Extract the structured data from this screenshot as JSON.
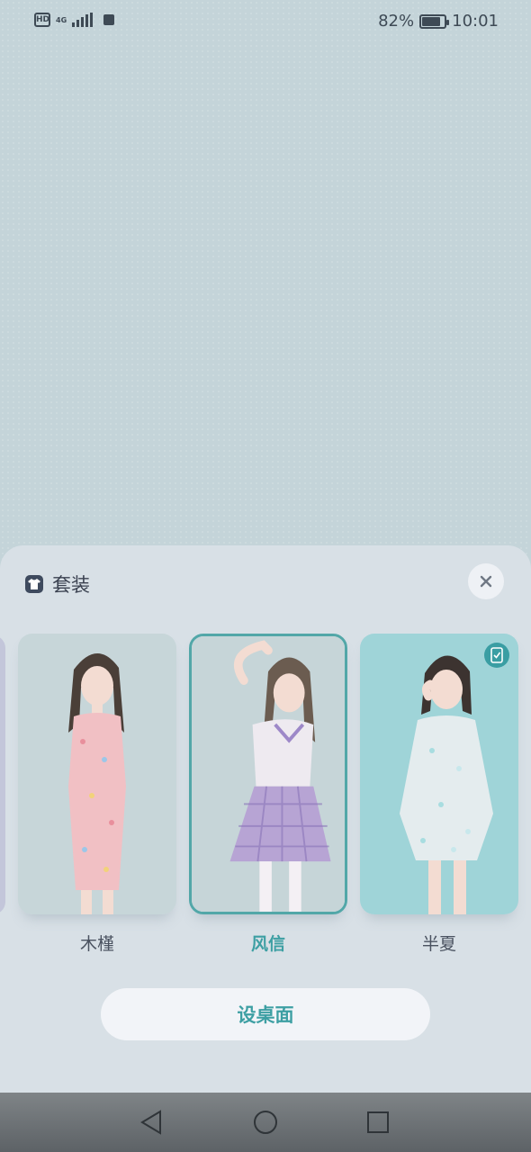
{
  "status_bar": {
    "hd_label": "HD",
    "network_label": "4G",
    "battery_percent_text": "82%",
    "battery_level": 0.82,
    "time": "10:01"
  },
  "sheet": {
    "title": "套装",
    "title_icon": "outfit-shirt-icon",
    "close_icon": "close-icon"
  },
  "outfits": [
    {
      "label": "木槿",
      "selected": false,
      "bg": "#c7d6d9",
      "dress": "#f1c0c4",
      "pattern": "floral-pink"
    },
    {
      "label": "风信",
      "selected": true,
      "bg": "#c6d5d8",
      "dress": "#b7a4d4",
      "pattern": "plaid-lavender"
    },
    {
      "label": "半夏",
      "selected": false,
      "bg": "#9fd4d8",
      "dress": "#e9eef0",
      "pattern": "sequin-sheer",
      "badge_icon": "phone-check-icon"
    }
  ],
  "apply_button": {
    "label": "设桌面"
  },
  "colors": {
    "accent": "#3d9fa3",
    "sheet_bg": "#d8e0e6",
    "background": "#c4d4d9"
  },
  "nav_bar": {
    "back_icon": "triangle-back-icon",
    "home_icon": "circle-home-icon",
    "recents_icon": "square-recents-icon"
  }
}
